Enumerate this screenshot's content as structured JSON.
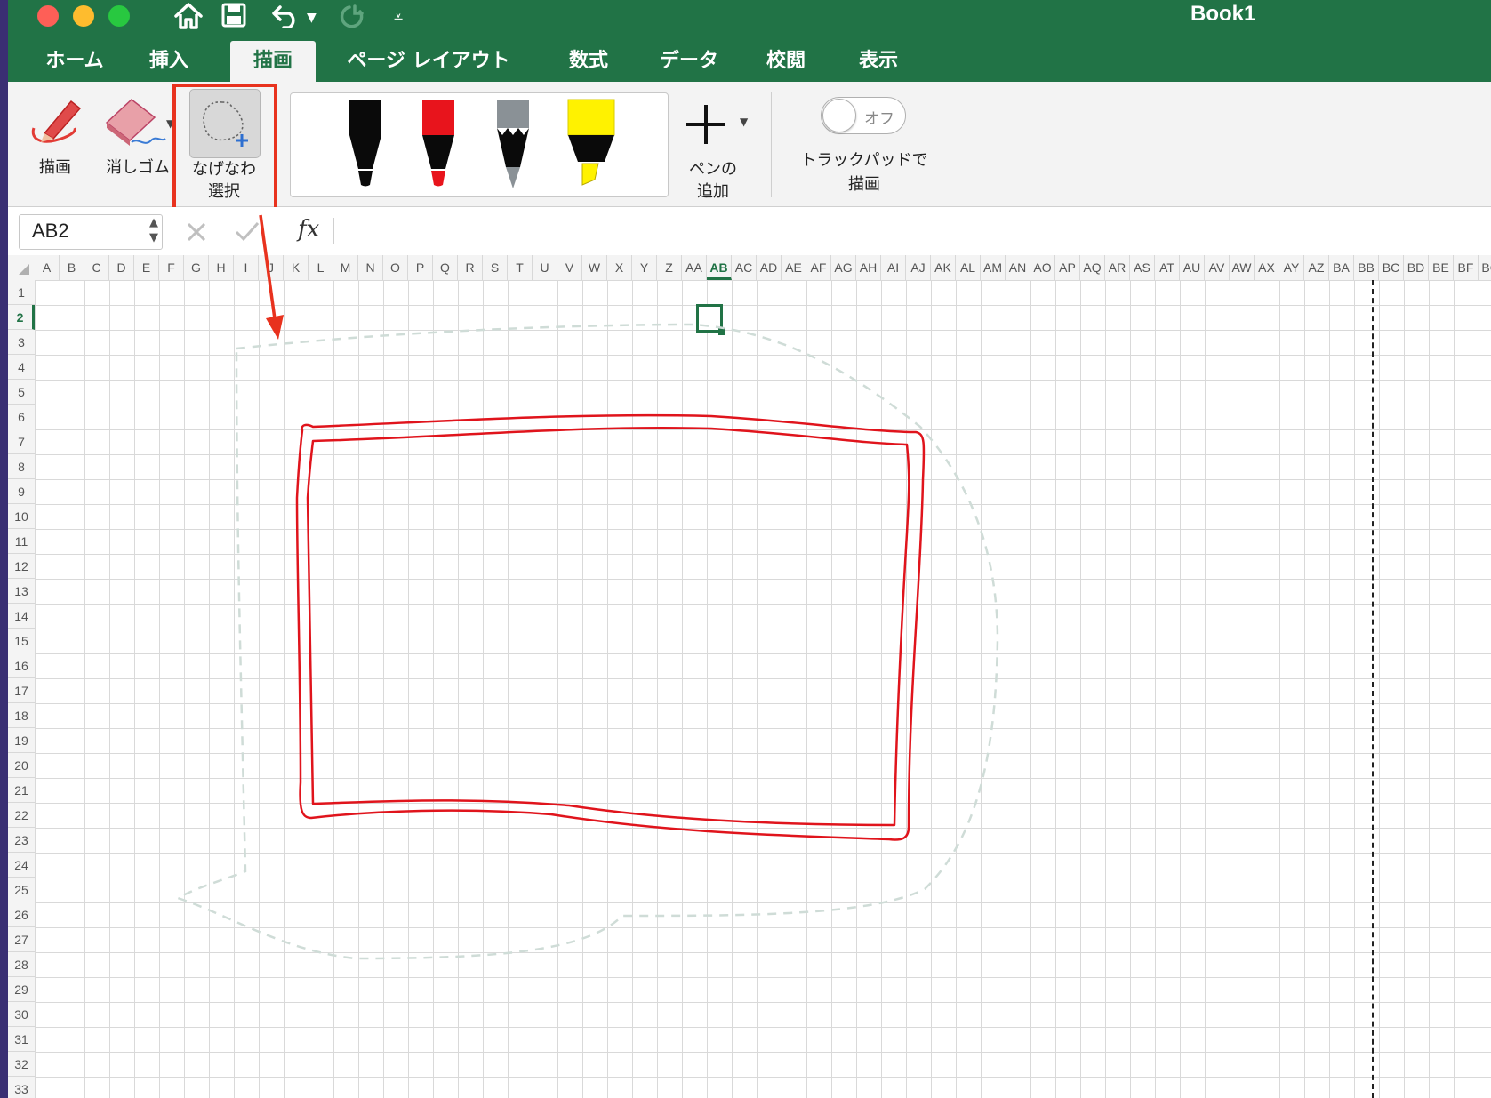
{
  "window": {
    "title": "Book1",
    "quick_access": [
      "home-icon",
      "save-icon",
      "undo-icon",
      "redo-icon",
      "customize-icon"
    ]
  },
  "tabs": [
    {
      "label": "ホーム"
    },
    {
      "label": "挿入"
    },
    {
      "label": "描画",
      "active": true
    },
    {
      "label": "ページ レイアウト"
    },
    {
      "label": "数式"
    },
    {
      "label": "データ"
    },
    {
      "label": "校閲"
    },
    {
      "label": "表示"
    }
  ],
  "ribbon": {
    "draw_label": "描画",
    "eraser_label": "消しゴム",
    "lasso_label_line1": "なげなわ",
    "lasso_label_line2": "選択",
    "pens": [
      {
        "name": "black-pen",
        "color": "#000000"
      },
      {
        "name": "red-pen",
        "color": "#e8141c"
      },
      {
        "name": "gray-pencil",
        "color": "#8a9196"
      },
      {
        "name": "yellow-highlighter",
        "color": "#fff200"
      }
    ],
    "add_pen_line1": "ペンの",
    "add_pen_line2": "追加",
    "trackpad_toggle_state": "オフ",
    "trackpad_label_line1": "トラックパッドで",
    "trackpad_label_line2": "描画"
  },
  "formula_bar": {
    "name_box": "AB2",
    "fx": "fx",
    "value": ""
  },
  "sheet": {
    "columns": [
      "A",
      "B",
      "C",
      "D",
      "E",
      "F",
      "G",
      "H",
      "I",
      "J",
      "K",
      "L",
      "M",
      "N",
      "O",
      "P",
      "Q",
      "R",
      "S",
      "T",
      "U",
      "V",
      "W",
      "X",
      "Y",
      "Z",
      "AA",
      "AB",
      "AC",
      "AD",
      "AE",
      "AF",
      "AG",
      "AH",
      "AI",
      "AJ",
      "AK",
      "AL",
      "AM",
      "AN",
      "AO",
      "AP",
      "AQ",
      "AR",
      "AS",
      "AT",
      "AU",
      "AV",
      "AW",
      "AX",
      "AY",
      "AZ",
      "BA",
      "BB",
      "BC",
      "BD",
      "BE",
      "BF",
      "BG"
    ],
    "rows": [
      "1",
      "2",
      "3",
      "4",
      "5",
      "6",
      "7",
      "8",
      "9",
      "10",
      "11",
      "12",
      "13",
      "14",
      "15",
      "16",
      "17",
      "18",
      "19",
      "20",
      "21",
      "22",
      "23",
      "24",
      "25",
      "26",
      "27",
      "28",
      "29",
      "30",
      "31",
      "32",
      "33"
    ],
    "selected_column": "AB",
    "selected_row": "2"
  },
  "colors": {
    "brand_green": "#217346",
    "highlight_red": "#e8321e",
    "ink_red": "#e0141c"
  }
}
